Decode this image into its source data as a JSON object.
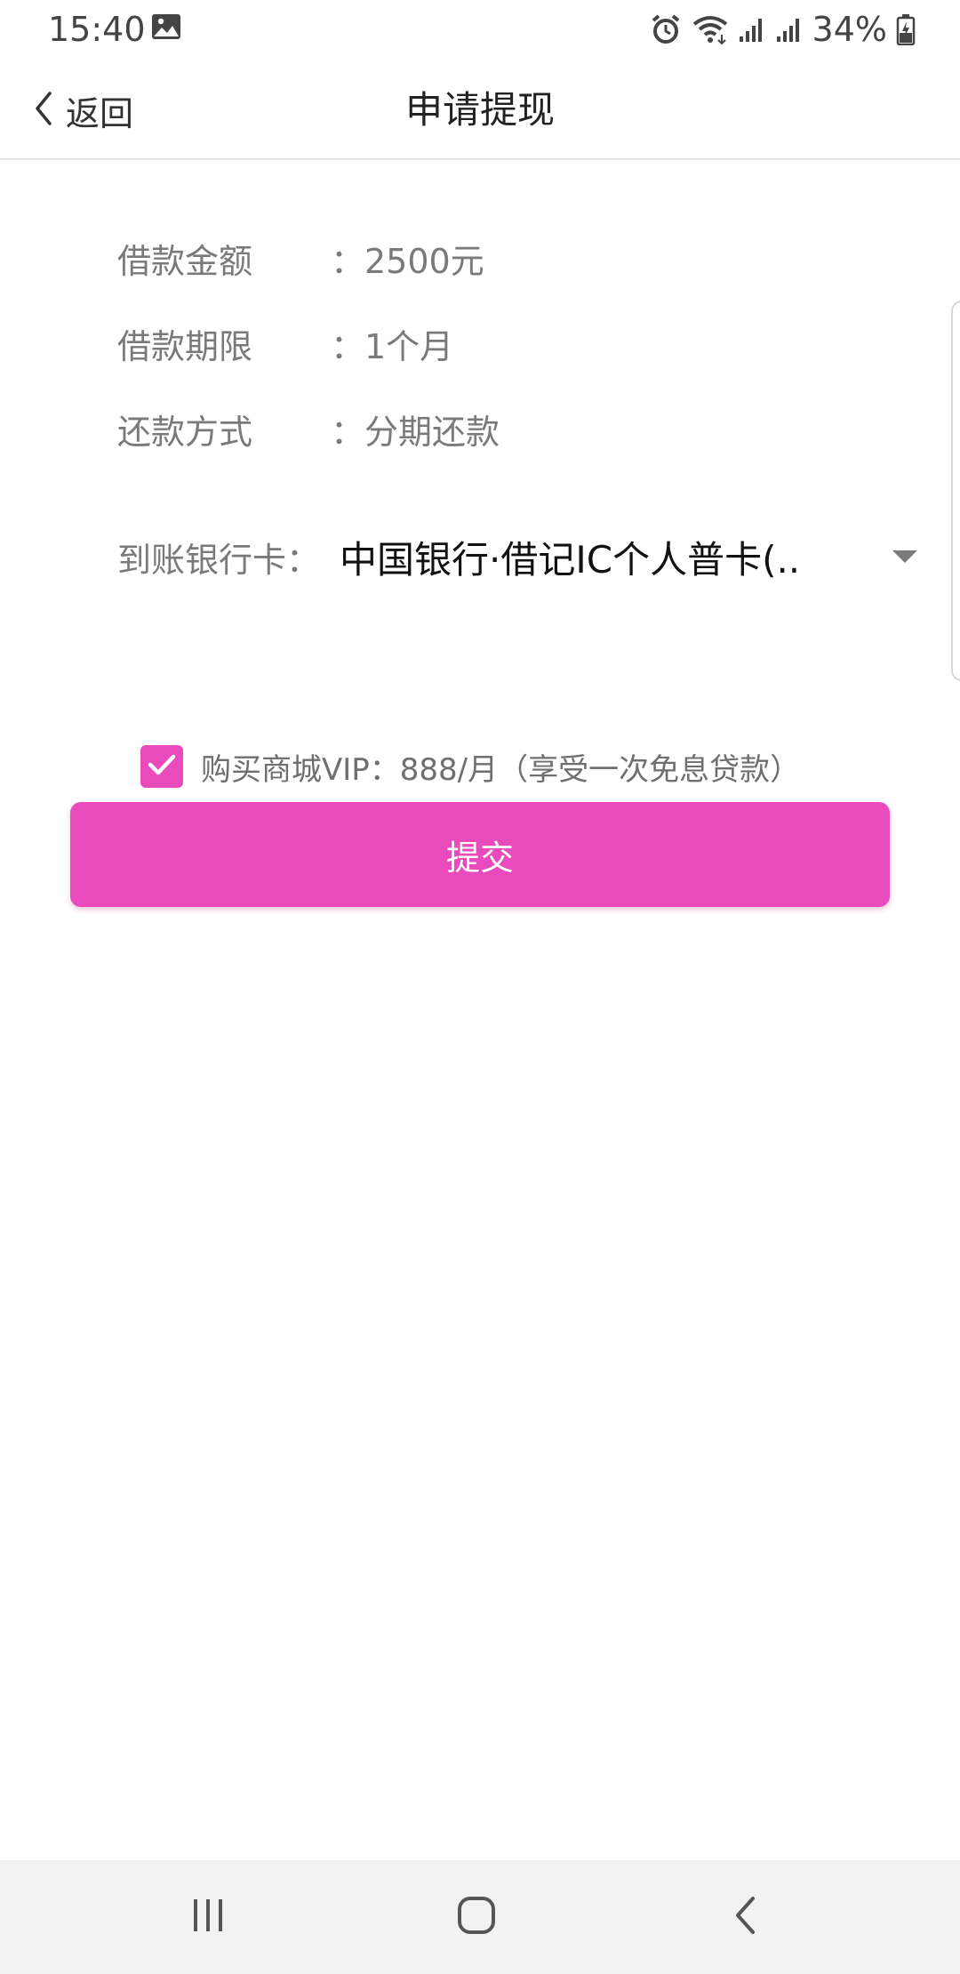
{
  "status_bar": {
    "time": "15:40",
    "battery": "34%",
    "icons": [
      "image-icon",
      "alarm-icon",
      "wifi-icon",
      "signal-icon",
      "signal-icon",
      "battery-charging-icon"
    ]
  },
  "header": {
    "back_label": "返回",
    "title": "申请提现"
  },
  "loan_info": {
    "amount": {
      "label": "借款金额",
      "value": "：2500元"
    },
    "term": {
      "label": "借款期限",
      "value": "：1个月"
    },
    "repayment": {
      "label": "还款方式",
      "value": "：分期还款"
    }
  },
  "bank": {
    "label": "到账银行卡：",
    "selected": "中国银行·借记IC个人普卡(.."
  },
  "vip": {
    "checked": true,
    "text": "购买商城VIP：888/月（享受一次免息贷款）"
  },
  "submit_label": "提交",
  "colors": {
    "accent": "#ea4bbc",
    "label_gray": "#7a7a7a",
    "nav_bg": "#f2f2f2"
  },
  "nav_bar": {
    "icons": [
      "recent-apps-icon",
      "home-icon",
      "back-icon"
    ]
  }
}
